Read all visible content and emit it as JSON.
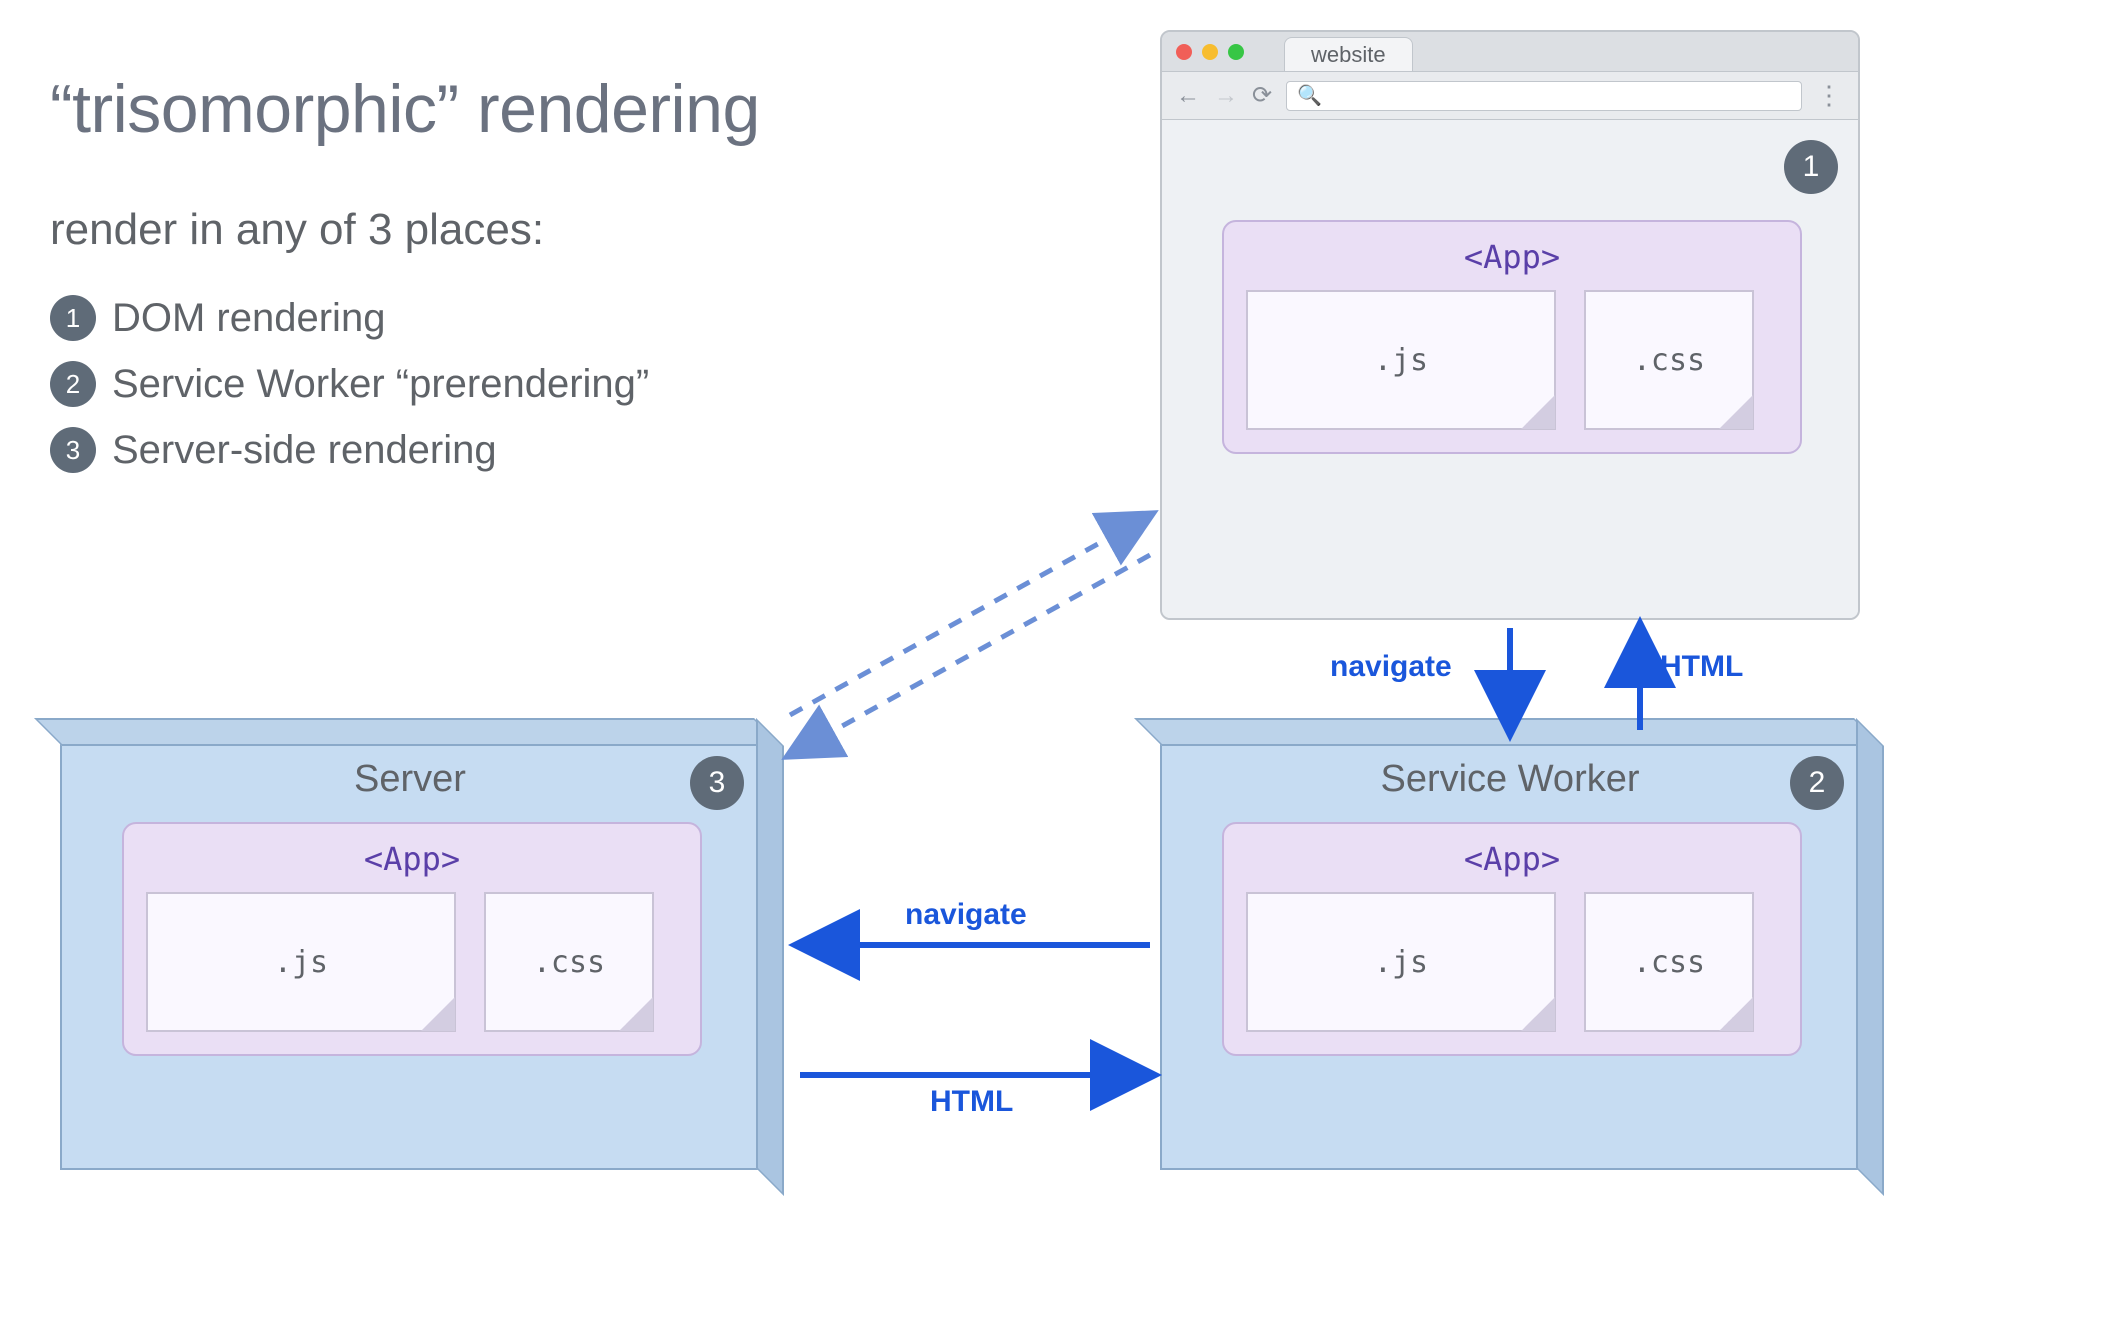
{
  "title": "“trisomorphic” rendering",
  "subtitle": "render in any of 3 places:",
  "places": [
    {
      "n": "1",
      "label": "DOM rendering"
    },
    {
      "n": "2",
      "label": "Service Worker “prerendering”"
    },
    {
      "n": "3",
      "label": "Server-side rendering"
    }
  ],
  "browser": {
    "tab_label": "website",
    "badge": "1",
    "app_label": "<App>",
    "file_js": ".js",
    "file_css": ".css",
    "search_glyph": "🔍"
  },
  "server_box": {
    "title": "Server",
    "badge": "3",
    "app_label": "<App>",
    "file_js": ".js",
    "file_css": ".css"
  },
  "sw_box": {
    "title": "Service Worker",
    "badge": "2",
    "app_label": "<App>",
    "file_js": ".js",
    "file_css": ".css"
  },
  "arrows": {
    "browser_sw_navigate": "navigate",
    "browser_sw_html": "HTML",
    "sw_server_navigate": "navigate",
    "sw_server_html": "HTML"
  },
  "colors": {
    "arrow_blue": "#1a56db",
    "dashed_blue": "#6b8fd6",
    "box_fill": "#c6dcf2",
    "box_edge": "#8aa9c9",
    "app_fill": "#eadff5",
    "app_edge": "#c5b4dd",
    "purple_text": "#5a3fa8",
    "badge_bg": "#5f6b78"
  }
}
